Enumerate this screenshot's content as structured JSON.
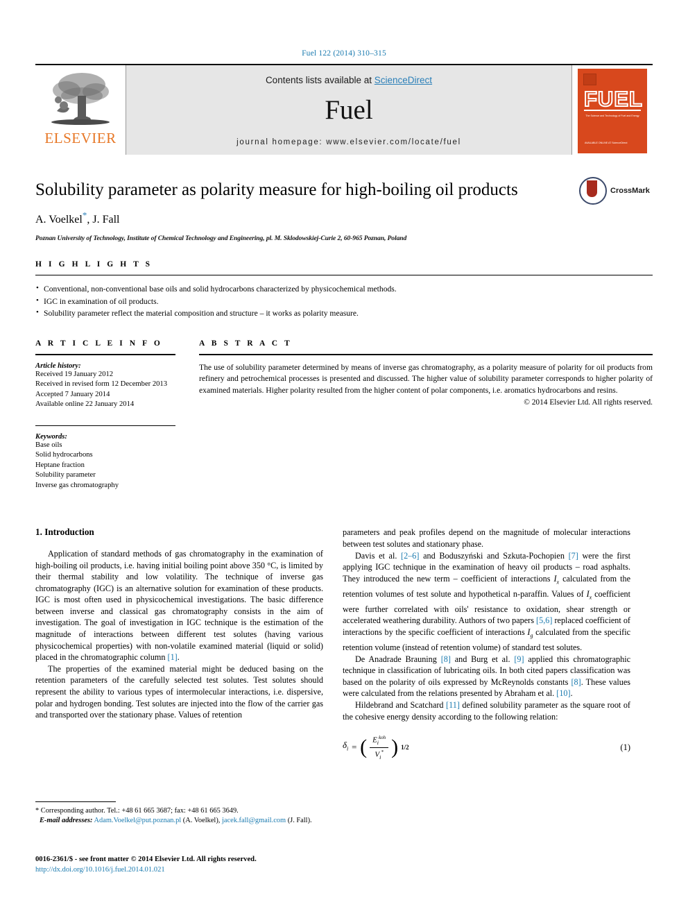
{
  "running_head": "Fuel 122 (2014) 310–315",
  "masthead": {
    "publisher_name": "ELSEVIER",
    "contents_prefix": "Contents lists available at ",
    "sciencedirect": "ScienceDirect",
    "journal_name": "Fuel",
    "homepage": "journal homepage: www.elsevier.com/locate/fuel",
    "cover": {
      "title": "FUEL",
      "subtitle": "The Science and Technology of Fuel and Energy",
      "bottom_text": "AVAILABLE ONLINE AT\nScienceDirect"
    }
  },
  "article": {
    "title": "Solubility parameter as polarity measure for high-boiling oil products",
    "authors": "A. Voelkel , J. Fall",
    "author_star": "*",
    "affiliation": "Poznan University of Technology, Institute of Chemical Technology and Engineering, pl. M. Sklodowskiej-Curie 2, 60-965 Poznan, Poland",
    "crossmark_label": "CrossMark"
  },
  "highlights": {
    "heading": "H I G H L I G H T S",
    "items": [
      "Conventional, non-conventional base oils and solid hydrocarbons characterized by physicochemical methods.",
      "IGC in examination of oil products.",
      "Solubility parameter reflect the material composition and structure – it works as polarity measure."
    ]
  },
  "article_info": {
    "heading": "A R T I C L E    I N F O",
    "history_title": "Article history:",
    "history": [
      "Received 19 January 2012",
      "Received in revised form 12 December 2013",
      "Accepted 7 January 2014",
      "Available online 22 January 2014"
    ],
    "keywords_title": "Keywords:",
    "keywords": [
      "Base oils",
      "Solid hydrocarbons",
      "Heptane fraction",
      "Solubility parameter",
      "Inverse gas chromatography"
    ]
  },
  "abstract": {
    "heading": "A B S T R A C T",
    "text": "The use of solubility parameter determined by means of inverse gas chromatography, as a polarity measure of polarity for oil products from refinery and petrochemical processes is presented and discussed. The higher value of solubility parameter corresponds to higher polarity of examined materials. Higher polarity resulted from the higher content of polar components, i.e. aromatics hydrocarbons and resins.",
    "copyright": "© 2014 Elsevier Ltd. All rights reserved."
  },
  "body": {
    "section_heading": "1. Introduction",
    "left_paragraph_1_a": "Application of standard methods of gas chromatography in the examination of high-boiling oil products, i.e. having initial boiling point above 350 °C, is limited by their thermal stability and low volatility. The technique of inverse gas chromatography (IGC) is an alternative solution for examination of these products. IGC is most often used in physicochemical investigations. The basic difference between inverse and classical gas chromatography consists in the aim of investigation. The goal of investigation in IGC technique is the estimation of the magnitude of interactions between different test solutes (having various physicochemical properties) with non-volatile examined material (liquid or solid) placed in the chromatographic column ",
    "left_paragraph_1_ref": "[1]",
    "left_paragraph_1_end": ".",
    "left_paragraph_2": "The properties of the examined material might be deduced basing on the retention parameters of the carefully selected test solutes. Test solutes should represent the ability to various types of intermolecular interactions, i.e. dispersive, polar and hydrogen bonding. Test solutes are injected into the flow of the carrier gas and transported over the stationary phase. Values of retention",
    "right_paragraph_1": "parameters and peak profiles depend on the magnitude of molecular interactions between test solutes and stationary phase.",
    "right_p2_a": "Davis et al. ",
    "right_p2_ref1": "[2–6]",
    "right_p2_b": " and Boduszyński and Szkuta-Pochopien ",
    "right_p2_ref2": "[7]",
    "right_p2_c": " were the first applying IGC technique in the examination of heavy oil products – road asphalts. They introduced the new term – coefficient of interactions ",
    "right_p2_sym1": "Ix",
    "right_p2_d": " calculated from the retention volumes of test solute and hypothetical n-paraffin. Values of ",
    "right_p2_sym2": "Ix",
    "right_p2_e": " coefficient were further correlated with oils' resistance to oxidation, shear strength or accelerated weathering durability. Authors of two papers ",
    "right_p2_ref3": "[5,6]",
    "right_p2_f": " replaced coefficient of interactions by the specific coefficient of interactions ",
    "right_p2_sym3": "Ig",
    "right_p2_g": " calculated from the specific retention volume (instead of retention volume) of standard test solutes.",
    "right_p3_a": "De Anadrade Brauning ",
    "right_p3_ref1": "[8]",
    "right_p3_b": " and Burg et al. ",
    "right_p3_ref2": "[9]",
    "right_p3_c": " applied this chromatographic technique in classification of lubricating oils. In both cited papers classification was based on the polarity of oils expressed by McReynolds constants ",
    "right_p3_ref3": "[8]",
    "right_p3_d": ". These values were calculated from the relations presented by Abraham et al. ",
    "right_p3_ref4": "[10]",
    "right_p3_e": ".",
    "right_p4_a": "Hildebrand and Scatchard ",
    "right_p4_ref1": "[11]",
    "right_p4_b": " defined solubility parameter as the square root of the cohesive energy density according to the following relation:",
    "equation": {
      "lhs": "δi",
      "equals": "=",
      "numerator": "Ei",
      "numerator_sup": "koh",
      "denominator": "Vi",
      "denominator_sup": "*",
      "exponent": "1/2",
      "number": "(1)"
    }
  },
  "footnotes": {
    "corresponding": "* Corresponding author. Tel.: +48 61 665 3687; fax: +48 61 665 3649.",
    "email_label": "E-mail addresses:",
    "email1": "Adam.Voelkel@put.poznan.pl",
    "email1_owner": "(A. Voelkel),",
    "email2": "jacek.fall@gmail.com",
    "email2_owner": "(J. Fall).",
    "issn_line": "0016-2361/$ - see front matter © 2014 Elsevier Ltd. All rights reserved.",
    "doi": "http://dx.doi.org/10.1016/j.fuel.2014.01.021"
  },
  "colors": {
    "link": "#1a7aaf",
    "elsevier_orange": "#e77726",
    "cover_orange": "#d8481d",
    "masthead_gray": "#e6e6e6"
  }
}
